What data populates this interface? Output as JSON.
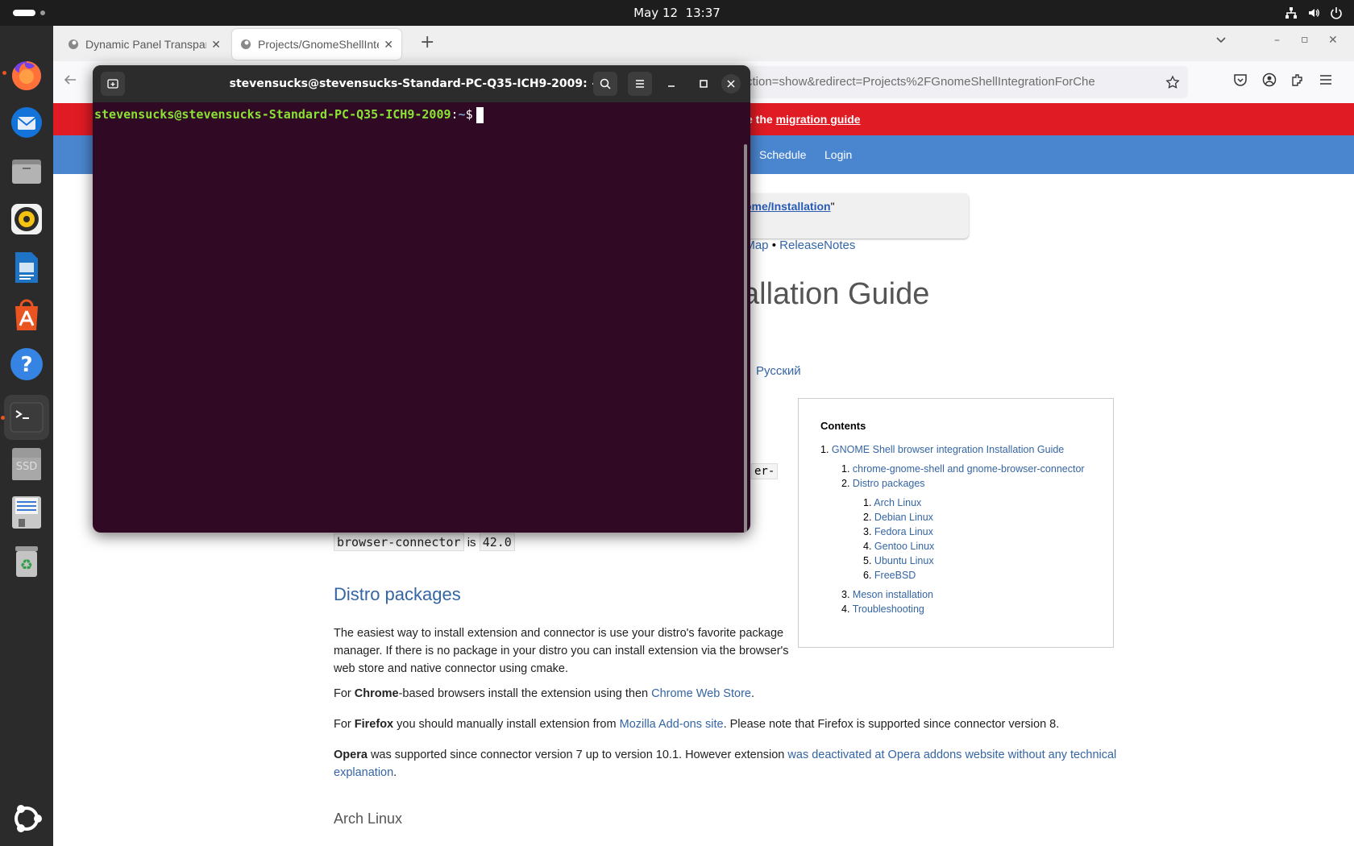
{
  "topbar": {
    "date": "May 12",
    "time": "13:37"
  },
  "dock": {
    "items": [
      "firefox-icon",
      "thunderbird-icon",
      "files-icon",
      "rhythmbox-icon",
      "writer-icon",
      "app-center-icon",
      "help-icon",
      "terminal-icon",
      "ssd-drive-icon",
      "floppy-drive-icon",
      "trash-icon",
      "ubuntu-apps-icon"
    ],
    "ssd_label": "SSD"
  },
  "browser": {
    "tabs": [
      {
        "label": "Dynamic Panel Transpare"
      },
      {
        "label": "Projects/GnomeShellInte"
      }
    ],
    "url": "ction=show&redirect=Projects%2FGnomeShellIntegrationForChe",
    "banner": {
      "prefix": "e the ",
      "link": "migration guide"
    },
    "nav_links": [
      "Schedule",
      "Login"
    ],
    "infobox": {
      "link": "ome/Installation",
      "suffix": "\""
    },
    "breadcrumbs": [
      "dMap",
      "ReleaseNotes"
    ],
    "breadcrumb_sep": "•",
    "heading": "allation Guide",
    "language": "Русский",
    "code_fragment": "er-",
    "connector_line": {
      "code1": "browser-connector",
      "word": "is",
      "code2": "42.0"
    },
    "toc": {
      "title": "Contents",
      "entries": [
        {
          "num": "1.",
          "label": "GNOME Shell browser integration Installation Guide"
        },
        {
          "num": "1.",
          "label": "chrome-gnome-shell and gnome-browser-connector"
        },
        {
          "num": "2.",
          "label": "Distro packages"
        },
        {
          "num": "1.",
          "label": "Arch Linux"
        },
        {
          "num": "2.",
          "label": "Debian Linux"
        },
        {
          "num": "3.",
          "label": "Fedora Linux"
        },
        {
          "num": "4.",
          "label": "Gentoo Linux"
        },
        {
          "num": "5.",
          "label": "Ubuntu Linux"
        },
        {
          "num": "6.",
          "label": "FreeBSD"
        },
        {
          "num": "3.",
          "label": "Meson installation"
        },
        {
          "num": "4.",
          "label": "Troubleshooting"
        }
      ]
    },
    "section_distro": "Distro packages",
    "para1": "The easiest way to install extension and connector is use your distro's favorite package manager. If there is no package in your distro you can install extension via the browser's web store and native connector using cmake.",
    "para2": {
      "a": "For ",
      "b": "Chrome",
      "c": "-based browsers install the extension using then ",
      "link": "Chrome Web Store",
      "d": "."
    },
    "para3": {
      "a": "For ",
      "b": "Firefox",
      "c": " you should manually install extension from ",
      "link": "Mozilla Add-ons site",
      "d": ". Please note that Firefox is supported since connector version 8."
    },
    "para4": {
      "b": "Opera",
      "c": " was supported since connector version 7 up to version 10.1. However extension ",
      "link": "was deactivated at Opera addons website without any technical explanation",
      "d": "."
    },
    "section_arch": "Arch Linux"
  },
  "terminal": {
    "title": "stevensucks@stevensucks-Standard-PC-Q35-ICH9-2009: ~",
    "prompt_user": "stevensucks@stevensucks-Standard-PC-Q35-ICH9-2009",
    "prompt_colon": ":",
    "prompt_path": "~",
    "prompt_symbol": "$",
    "colors": {
      "background": "#300a24",
      "prompt": "#8ae234",
      "path": "#729fcf"
    }
  }
}
